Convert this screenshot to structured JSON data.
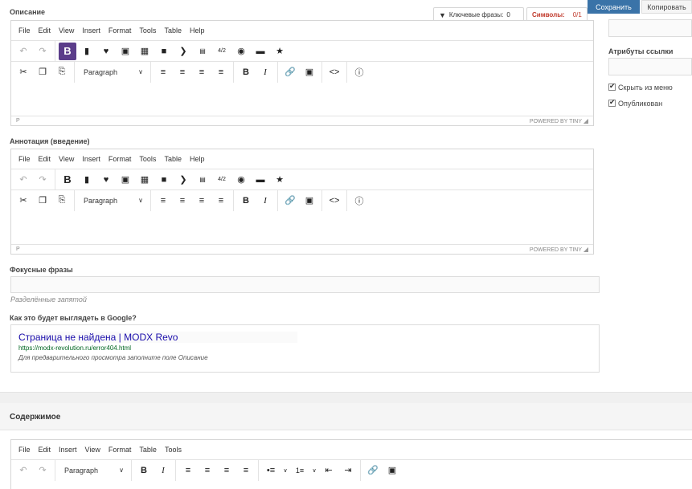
{
  "sections": {
    "description_label": "Описание",
    "annotation_label": "Аннотация (введение)",
    "focus_label": "Фокусные фразы",
    "focus_hint": "Разделённые запятой",
    "google_label": "Как это будет выглядеть в Google?",
    "content_header": "Содержимое"
  },
  "tabs": {
    "keywords_label": "Ключевые фразы:",
    "keywords_count": "0",
    "symbols_label": "Символы:",
    "symbols_count": "0/1"
  },
  "buttons": {
    "save": "Сохранить",
    "copy": "Копировать"
  },
  "sidebar": {
    "link_attrs_label": "Атрибуты ссылки",
    "hide_menu": "Скрыть из меню",
    "published": "Опубликован"
  },
  "editor": {
    "menu": [
      "File",
      "Edit",
      "View",
      "Insert",
      "Format",
      "Tools",
      "Table",
      "Help"
    ],
    "block_format": "Paragraph",
    "status_path": "P",
    "powered_by": "POWERED BY TINY"
  },
  "content_editor": {
    "menu": [
      "File",
      "Edit",
      "Insert",
      "View",
      "Format",
      "Table",
      "Tools"
    ],
    "block_format": "Paragraph"
  },
  "google_preview": {
    "title": "Страница не найдена | MODX Revo",
    "url": "https://modx-revolution.ru/error404.html",
    "description": "Для предварительного просмотра заполните поле Описание"
  }
}
